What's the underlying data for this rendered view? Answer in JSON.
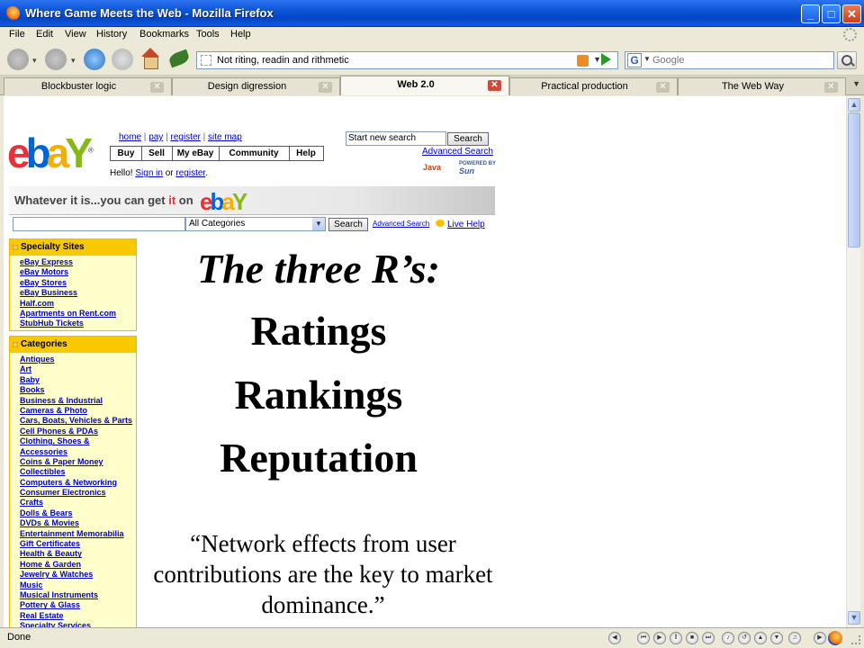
{
  "window": {
    "title": "Where Game Meets the Web - Mozilla Firefox",
    "minimize": "_",
    "maximize": "□",
    "close": "✕"
  },
  "menu": {
    "items": [
      "File",
      "Edit",
      "View",
      "History",
      "Bookmarks",
      "Tools",
      "Help"
    ]
  },
  "toolbar": {
    "url": "Not riting, readin and rithmetic",
    "search_placeholder": "Google"
  },
  "tabs": [
    {
      "label": "Blockbuster logic",
      "active": false
    },
    {
      "label": "Design digression",
      "active": false
    },
    {
      "label": "Web 2.0",
      "active": true
    },
    {
      "label": "Practical production",
      "active": false
    },
    {
      "label": "The Web Way",
      "active": false
    }
  ],
  "ebay": {
    "logo": {
      "e": "e",
      "b": "b",
      "a": "a",
      "y": "Y",
      "reg": "®"
    },
    "toplinks": [
      "home",
      "pay",
      "register",
      "site map"
    ],
    "nav_tabs": [
      "Buy",
      "Sell",
      "My eBay",
      "Community",
      "Help"
    ],
    "hello_prefix": "Hello! ",
    "sign_in": "Sign in",
    "hello_or": " or ",
    "register": "register",
    "hello_suffix": ".",
    "top_search_placeholder": "Start new search",
    "search_button": "Search",
    "advanced_search": "Advanced Search",
    "java": "Java",
    "powered_by": "POWERED BY",
    "sun": "Sun",
    "banner_pre": "Whatever it is...you can get ",
    "banner_it": "it",
    "banner_on": " on ",
    "category_select": "All Categories",
    "main_search_button": "Search",
    "advanced_search_small": "Advanced Search",
    "live_help": "Live Help",
    "specialty_title": "Specialty Sites",
    "specialty_sites": [
      "eBay Express",
      "eBay Motors",
      "eBay Stores",
      "eBay Business",
      "Half.com",
      "Apartments on Rent.com",
      "StubHub Tickets"
    ],
    "categories_title": "Categories",
    "categories": [
      "Antiques",
      "Art",
      "Baby",
      "Books",
      "Business & Industrial",
      "Cameras & Photo",
      "Cars, Boats, Vehicles & Parts",
      "Cell Phones & PDAs",
      "Clothing, Shoes &",
      "Accessories",
      "Coins & Paper Money",
      "Collectibles",
      "Computers & Networking",
      "Consumer Electronics",
      "Crafts",
      "Dolls & Bears",
      "DVDs & Movies",
      "Entertainment Memorabilia",
      "Gift Certificates",
      "Health & Beauty",
      "Home & Garden",
      "Jewelry & Watches",
      "Music",
      "Musical Instruments",
      "Pottery & Glass",
      "Real Estate",
      "Specialty Services"
    ]
  },
  "slide": {
    "title": "The three R’s:",
    "lines": [
      "Ratings",
      "Rankings",
      "Reputation"
    ],
    "quote": "“Network effects from user contributions are the key to market dominance.”"
  },
  "status": {
    "text": "Done"
  }
}
